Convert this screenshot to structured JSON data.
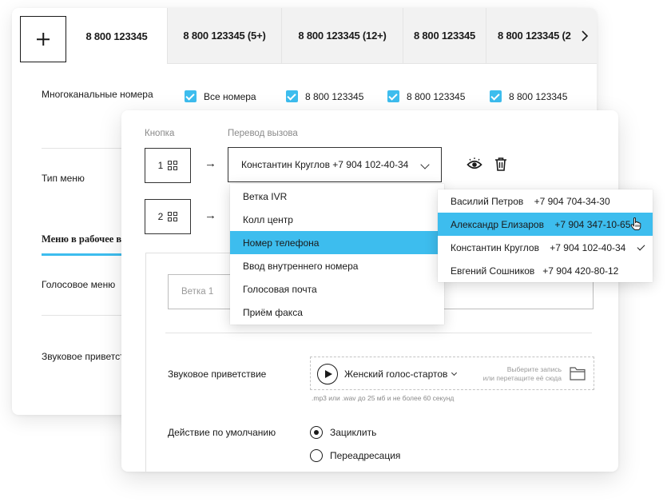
{
  "tabs": {
    "items": [
      {
        "label": "8 800 123345"
      },
      {
        "label": "8 800 123345 (5+)"
      },
      {
        "label": "8 800 123345 (12+)"
      },
      {
        "label": "8 800 123345"
      },
      {
        "label": "8 800 123345 (2"
      }
    ]
  },
  "multichannel": {
    "label": "Многоканальные номера",
    "options": [
      {
        "label": "Все номера",
        "checked": true
      },
      {
        "label": "8 800 123345",
        "checked": true
      },
      {
        "label": "8 800 123345",
        "checked": true
      },
      {
        "label": "8 800 123345",
        "checked": true
      }
    ]
  },
  "sidebar": {
    "menu_type": "Тип меню",
    "work_menu": "Меню в рабочее в",
    "voice_menu": "Голосовое меню",
    "sound_greeting": "Звуковое приветст"
  },
  "editor": {
    "col_button": "Кнопка",
    "col_transfer": "Перевод вызова",
    "row1_button": "1",
    "row2_button": "2",
    "arrow": "→",
    "transfer_value": "Константин Круглов  +7 904 102-40-34",
    "branch_placeholder": "Ветка 1",
    "greeting_label": "Звуковое приветствие",
    "voice_name": "Женский голос-стартов",
    "upload_hint_1": "Выберите запись",
    "upload_hint_2": "или перетащите её сюда",
    "upload_note": ".mp3 или .wav до 25 мб и не более 60 секунд",
    "default_action_label": "Действие по умолчанию",
    "radio_options": [
      {
        "label": "Зациклить",
        "selected": true
      },
      {
        "label": "Переадресация",
        "selected": false
      }
    ]
  },
  "type_dropdown": {
    "items": [
      "Ветка IVR",
      "Колл центр",
      "Номер телефона",
      "Ввод внутреннего номера",
      "Голосовая почта",
      "Приём факса"
    ],
    "selected_index": 2
  },
  "contact_dropdown": {
    "items": [
      "Василий Петров    +7 904 704-34-30",
      "Александр Елизаров    +7 904 347-10-65",
      "Константин Круглов    +7 904 102-40-34",
      "Евгений Сошников   +7 904 420-80-12"
    ],
    "hovered_index": 1,
    "checked_index": 2
  },
  "colors": {
    "accent": "#3dbdee",
    "text": "#1a1a1a",
    "muted": "#8a8a8a"
  }
}
